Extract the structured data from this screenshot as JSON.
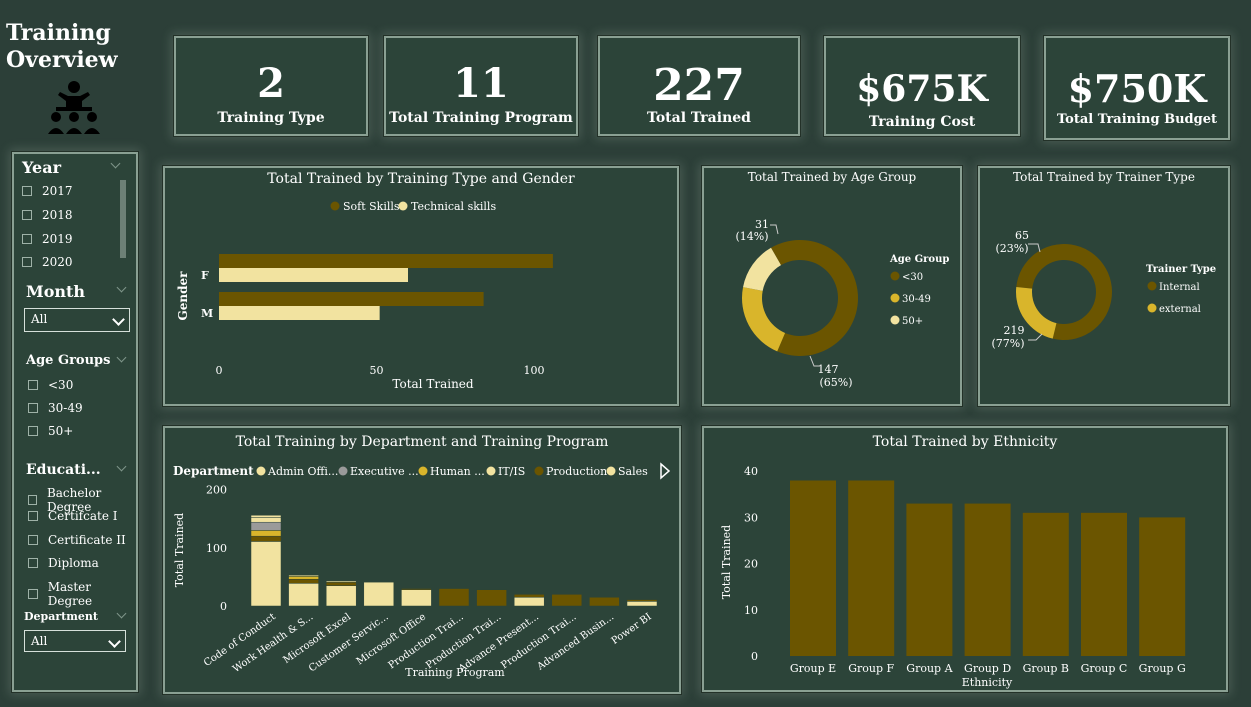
{
  "page": {
    "title": "Training Overview"
  },
  "kpis": [
    {
      "value": "2",
      "label": "Training Type"
    },
    {
      "value": "11",
      "label": "Total Training Program"
    },
    {
      "value": "227",
      "label": "Total Trained"
    },
    {
      "value": "$675K",
      "label": "Training Cost"
    },
    {
      "value": "$750K",
      "label": "Total Training Budget"
    }
  ],
  "filters": {
    "year": {
      "header": "Year",
      "items": [
        "2017",
        "2018",
        "2019",
        "2020"
      ]
    },
    "month": {
      "header": "Month",
      "selected": "All"
    },
    "age_groups": {
      "header": "Age Groups",
      "items": [
        "<30",
        "30-49",
        "50+"
      ]
    },
    "education": {
      "header": "Educati...",
      "items": [
        "Bachelor Degree",
        "Certifcate I",
        "Certificate II",
        "Diploma",
        "Master Degree"
      ]
    },
    "department": {
      "header": "Department",
      "selected": "All"
    }
  },
  "colors": {
    "dark": "#6b5500",
    "mid": "#d9b52b",
    "light": "#f2e3a0",
    "gray": "#9a9a9a",
    "panel": "#2c4439"
  },
  "chart_data": [
    {
      "id": "gender",
      "type": "bar",
      "title": "Total Trained by Training Type and Gender",
      "xlabel": "Total Trained",
      "ylabel": "Gender",
      "categories": [
        "F",
        "M"
      ],
      "series": [
        {
          "name": "Soft Skills",
          "values": [
            106,
            84
          ],
          "color": "#6b5500"
        },
        {
          "name": "Technical skills",
          "values": [
            60,
            51
          ],
          "color": "#f2e3a0"
        }
      ],
      "xticks": [
        "0",
        "50",
        "100"
      ],
      "xlim": [
        0,
        120
      ],
      "legend": "top"
    },
    {
      "id": "age",
      "type": "pie",
      "title": "Total Trained by Age Group",
      "legend_title": "Age Group",
      "labels": [
        "<30",
        "30-49",
        "50+"
      ],
      "values": [
        147,
        49,
        31
      ],
      "colors": [
        "#6b5500",
        "#d9b52b",
        "#f2e3a0"
      ],
      "data_labels": [
        {
          "value": "147",
          "pct": "(65%)"
        },
        {
          "value": "31",
          "pct": "(14%)"
        }
      ]
    },
    {
      "id": "trainer",
      "type": "pie",
      "title": "Total Trained by Trainer Type",
      "legend_title": "Trainer Type",
      "labels": [
        "Internal",
        "external"
      ],
      "values": [
        219,
        65
      ],
      "colors": [
        "#6b5500",
        "#d9b52b"
      ],
      "data_labels": [
        {
          "value": "65",
          "pct": "(23%)"
        },
        {
          "value": "219",
          "pct": "(77%)"
        }
      ]
    },
    {
      "id": "department",
      "type": "bar",
      "title": "Total Training by Department and Training Program",
      "xlabel": "Training Program",
      "ylabel": "Total Trained",
      "legend_title": "Department",
      "legend": [
        "Admin Offi...",
        "Executive ...",
        "Human ...",
        "IT/IS",
        "Production",
        "Sales"
      ],
      "legend_colors": [
        "#f2e3a0",
        "#9a9a9a",
        "#d9b52b",
        "#f2e3a0",
        "#6b5500",
        "#f2e3a0"
      ],
      "categories": [
        "Code of Conduct",
        "Work Health & S...",
        "Microsoft Excel",
        "Customer Servic...",
        "Microsoft Office",
        "Production Trai...",
        "Production Trai...",
        "Advance Present...",
        "Production Trai...",
        "Advanced Busin...",
        "Power BI"
      ],
      "series": [
        {
          "name": "Sales",
          "values": [
            111,
            39,
            35,
            41,
            28,
            0,
            0,
            15,
            0,
            0,
            8
          ],
          "color": "#f2e3a0"
        },
        {
          "name": "Production",
          "values": [
            9,
            7,
            6,
            0,
            2,
            30,
            28,
            5,
            20,
            15,
            3
          ],
          "color": "#6b5500"
        },
        {
          "name": "Human ...",
          "values": [
            10,
            5,
            0,
            0,
            0,
            0,
            0,
            0,
            0,
            0,
            0
          ],
          "color": "#d9b52b"
        },
        {
          "name": "Executive ...",
          "values": [
            14,
            0,
            0,
            0,
            0,
            0,
            0,
            0,
            0,
            0,
            0
          ],
          "color": "#9a9a9a"
        },
        {
          "name": "Admin Offi...",
          "values": [
            8,
            0,
            0,
            0,
            0,
            0,
            0,
            0,
            0,
            0,
            0
          ],
          "color": "#f2e3a0"
        },
        {
          "name": "IT/IS",
          "values": [
            4,
            2,
            2,
            0,
            0,
            0,
            0,
            0,
            0,
            0,
            0
          ],
          "color": "#f2e3a0"
        }
      ],
      "yticks": [
        "0",
        "100",
        "200"
      ],
      "ylim": [
        0,
        220
      ]
    },
    {
      "id": "ethnicity",
      "type": "bar",
      "title": "Total Trained by Ethnicity",
      "xlabel": "Ethnicity",
      "ylabel": "Total Trained",
      "categories": [
        "Group E",
        "Group F",
        "Group A",
        "Group D",
        "Group B",
        "Group C",
        "Group G"
      ],
      "values": [
        38,
        38,
        33,
        33,
        31,
        31,
        30
      ],
      "color": "#6b5500",
      "yticks": [
        "0",
        "10",
        "20",
        "30",
        "40"
      ],
      "ylim": [
        0,
        42
      ]
    }
  ]
}
